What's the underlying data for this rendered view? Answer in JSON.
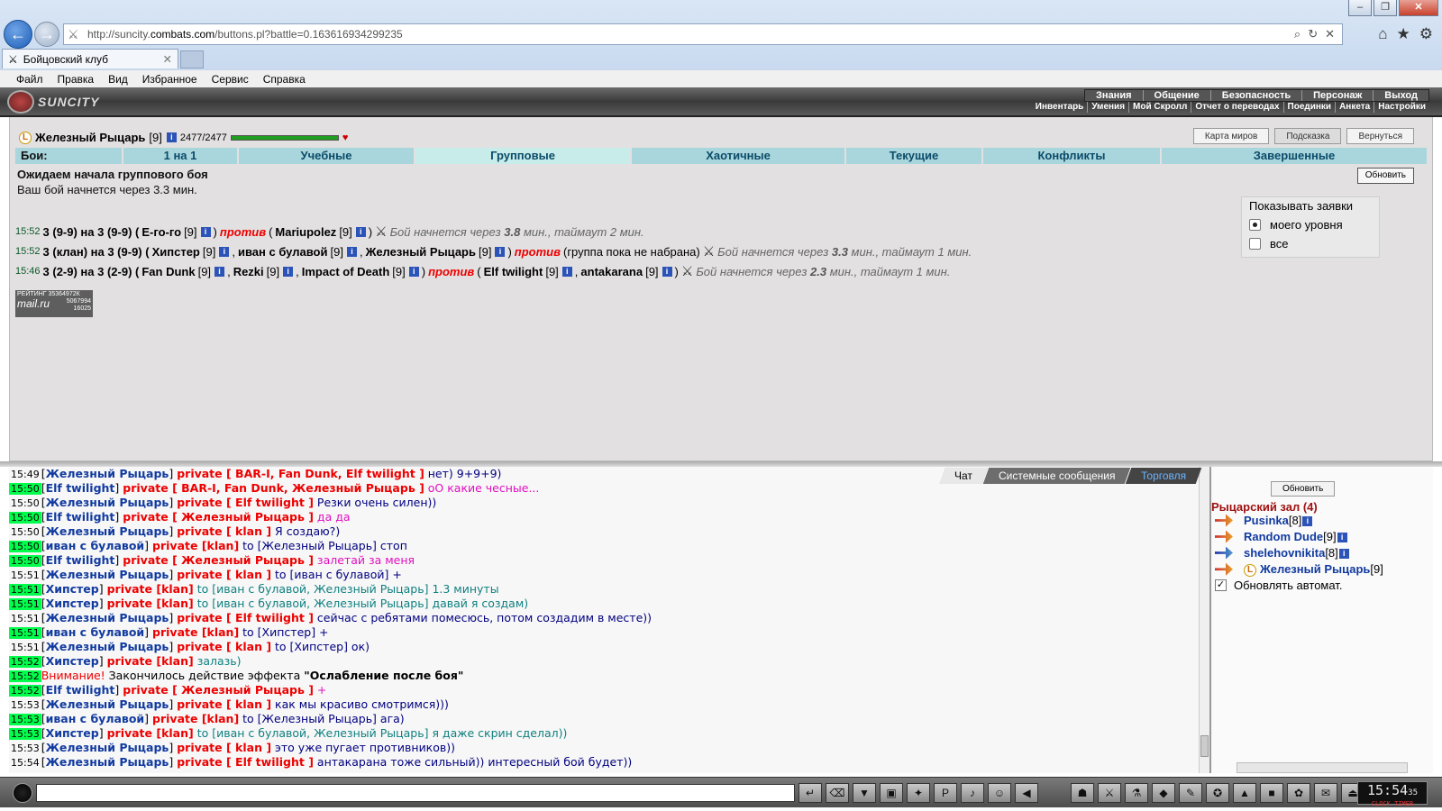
{
  "browser": {
    "url_prefix": "http://suncity.",
    "url_domain": "combats.com",
    "url_rest": "/buttons.pl?battle=0.163616934299235",
    "tab_title": "Бойцовский клуб",
    "menu": [
      "Файл",
      "Правка",
      "Вид",
      "Избранное",
      "Сервис",
      "Справка"
    ]
  },
  "site": {
    "logo": "SUNCITY",
    "topmenu": [
      "Знания",
      "Общение",
      "Безопасность",
      "Персонаж",
      "Выход"
    ],
    "submenu": [
      "Инвентарь",
      "Умения",
      "Мой Скролл",
      "Отчет о переводах",
      "Поединки",
      "Анкета",
      "Настройки"
    ]
  },
  "player": {
    "name": "Железный Рыцарь",
    "level": "[9]",
    "hp": "2477/2477",
    "hp_fraction": 1.0
  },
  "top_buttons": [
    "Карта миров",
    "Подсказка",
    "Вернуться"
  ],
  "battle_tabs": [
    "Бои:",
    "1 на 1",
    "Учебные",
    "Групповые",
    "Хаотичные",
    "Текущие",
    "Конфликты",
    "Завершенные"
  ],
  "status": {
    "title": "Ожидаем начала группового боя",
    "subtitle": "Ваш бой начнется через 3.3 мин.",
    "refresh": "Обновить"
  },
  "battles": [
    {
      "time": "15:52",
      "head": "3 (9-9) на 3 (9-9) (",
      "team1": [
        {
          "name": "E-го-го",
          "lvl": "[9]"
        }
      ],
      "mid": ") против (",
      "team2": [
        {
          "name": "Mariupolez",
          "lvl": "[9]"
        }
      ],
      "tail": ")",
      "info": "Бой начнется через",
      "mins": "3.8",
      "rest": "мин., таймаут 2 мин."
    },
    {
      "time": "15:52",
      "head": "3 (клан) на 3 (9-9) (",
      "team1": [
        {
          "name": "Хипстер",
          "lvl": "[9]"
        },
        {
          "name": "иван с булавой",
          "lvl": "[9]"
        },
        {
          "name": "Железный Рыцарь",
          "lvl": "[9]"
        }
      ],
      "mid": ") против (группа пока не набрана)",
      "team2": [],
      "tail": "",
      "info": "Бой начнется через",
      "mins": "3.3",
      "rest": "мин., таймаут 1 мин."
    },
    {
      "time": "15:46",
      "head": "3 (2-9) на 3 (2-9) (",
      "team1": [
        {
          "name": "Fan Dunk",
          "lvl": "[9]"
        },
        {
          "name": "Rezki",
          "lvl": "[9]"
        },
        {
          "name": "Impact of Death",
          "lvl": "[9]"
        }
      ],
      "mid": ") против (",
      "team2": [
        {
          "name": "Elf twilight",
          "lvl": "[9]"
        },
        {
          "name": "antakarana",
          "lvl": "[9]"
        }
      ],
      "tail": ")",
      "info": "Бой начнется через",
      "mins": "2.3",
      "rest": "мин., таймаут 1 мин."
    }
  ],
  "show_requests": {
    "title": "Показывать заявки",
    "options": [
      "моего уровня",
      "все"
    ],
    "selected": 0
  },
  "counter": {
    "line1": "РЕЙТИНГ 35364972К",
    "brand": "mail.ru",
    "n1": "5067994",
    "n2": "16025"
  },
  "chat_tabs": [
    "Чат",
    "Системные сообщения",
    "Торговля"
  ],
  "chat": [
    {
      "t": "15:49",
      "g": false,
      "who": "Железный Рыцарь",
      "to": "private [ BAR-I, Fan Dunk, Elf twilight ]",
      "msg": "нет) 9+9+9)",
      "c": "#000080"
    },
    {
      "t": "15:50",
      "g": true,
      "who": "Elf twilight",
      "to": "private [ BAR-I, Fan Dunk, Железный Рыцарь ]",
      "msg": "оО какие чесные...",
      "c": "#e010c0"
    },
    {
      "t": "15:50",
      "g": false,
      "who": "Железный Рыцарь",
      "to": "private [ Elf twilight ]",
      "msg": "Резки очень силен))",
      "c": "#000080"
    },
    {
      "t": "15:50",
      "g": true,
      "who": "Elf twilight",
      "to": "private [ Железный Рыцарь ]",
      "msg": "да да",
      "c": "#e010c0"
    },
    {
      "t": "15:50",
      "g": false,
      "who": "Железный Рыцарь",
      "to": "private [ klan ]",
      "msg": "Я создаю?)",
      "c": "#000080"
    },
    {
      "t": "15:50",
      "g": true,
      "who": "иван с булавой",
      "to": "private [klan]",
      "msg": "to [Железный Рыцарь] стоп",
      "c": "#000080"
    },
    {
      "t": "15:50",
      "g": true,
      "who": "Elf twilight",
      "to": "private [ Железный Рыцарь ]",
      "msg": "залетай за меня",
      "c": "#e010c0"
    },
    {
      "t": "15:51",
      "g": false,
      "who": "Железный Рыцарь",
      "to": "private [ klan ]",
      "msg": "to [иван с булавой] +",
      "c": "#000080"
    },
    {
      "t": "15:51",
      "g": true,
      "who": "Хипстер",
      "to": "private [klan]",
      "msg": "to [иван с булавой, Железный Рыцарь] 1.3 минуты",
      "c": "#108080"
    },
    {
      "t": "15:51",
      "g": true,
      "who": "Хипстер",
      "to": "private [klan]",
      "msg": "to [иван с булавой, Железный Рыцарь] давай я создам)",
      "c": "#108080"
    },
    {
      "t": "15:51",
      "g": false,
      "who": "Железный Рыцарь",
      "to": "private [ Elf twilight ]",
      "msg": "сейчас с ребятами помесюсь, потом создадим в месте))",
      "c": "#000080"
    },
    {
      "t": "15:51",
      "g": true,
      "who": "иван с булавой",
      "to": "private [klan]",
      "msg": "to [Хипстер] +",
      "c": "#000080"
    },
    {
      "t": "15:51",
      "g": false,
      "who": "Железный Рыцарь",
      "to": "private [ klan ]",
      "msg": "to [Хипстер] ок)",
      "c": "#000080"
    },
    {
      "t": "15:52",
      "g": true,
      "who": "Хипстер",
      "to": "private [klan]",
      "msg": "залазь)",
      "c": "#108080"
    },
    {
      "t": "15:52",
      "g": true,
      "sys": true,
      "warn": "Внимание!",
      "msg": "Закончилось действие эффекта ",
      "effect": "\"Ослабление после боя\""
    },
    {
      "t": "15:52",
      "g": true,
      "who": "Elf twilight",
      "to": "private [ Железный Рыцарь ]",
      "msg": "+",
      "c": "#e010c0"
    },
    {
      "t": "15:53",
      "g": false,
      "who": "Железный Рыцарь",
      "to": "private [ klan ]",
      "msg": "как мы красиво смотримся)))",
      "c": "#000080"
    },
    {
      "t": "15:53",
      "g": true,
      "who": "иван с булавой",
      "to": "private [klan]",
      "msg": "to [Железный Рыцарь] ага)",
      "c": "#000080"
    },
    {
      "t": "15:53",
      "g": true,
      "who": "Хипстер",
      "to": "private [klan]",
      "msg": "to [иван с булавой, Железный Рыцарь] я даже скрин сделал))",
      "c": "#108080"
    },
    {
      "t": "15:53",
      "g": false,
      "who": "Железный Рыцарь",
      "to": "private [ klan ]",
      "msg": "это уже пугает противников))",
      "c": "#000080"
    },
    {
      "t": "15:54",
      "g": false,
      "who": "Железный Рыцарь",
      "to": "private [ Elf twilight ]",
      "msg": "антакарана тоже сильный)) интересный бой будет))",
      "c": "#000080"
    }
  ],
  "sidebar": {
    "refresh": "Обновить",
    "hall": "Рыцарский зал (4)",
    "players": [
      {
        "name": "Pusinka",
        "lvl": "[8]",
        "icon": "arrow"
      },
      {
        "name": "Random Dude",
        "lvl": "[9]",
        "icon": "arrow"
      },
      {
        "name": "shelehovnikita",
        "lvl": "[8]",
        "icon": "arrow-blue"
      },
      {
        "name": "Железный Рыцарь",
        "lvl": "[9]",
        "icon": "arrow"
      }
    ],
    "auto": "Обновлять автомат."
  },
  "clock": {
    "time": "15:54",
    "sec": "35",
    "label": "CLOCK TIMER"
  }
}
